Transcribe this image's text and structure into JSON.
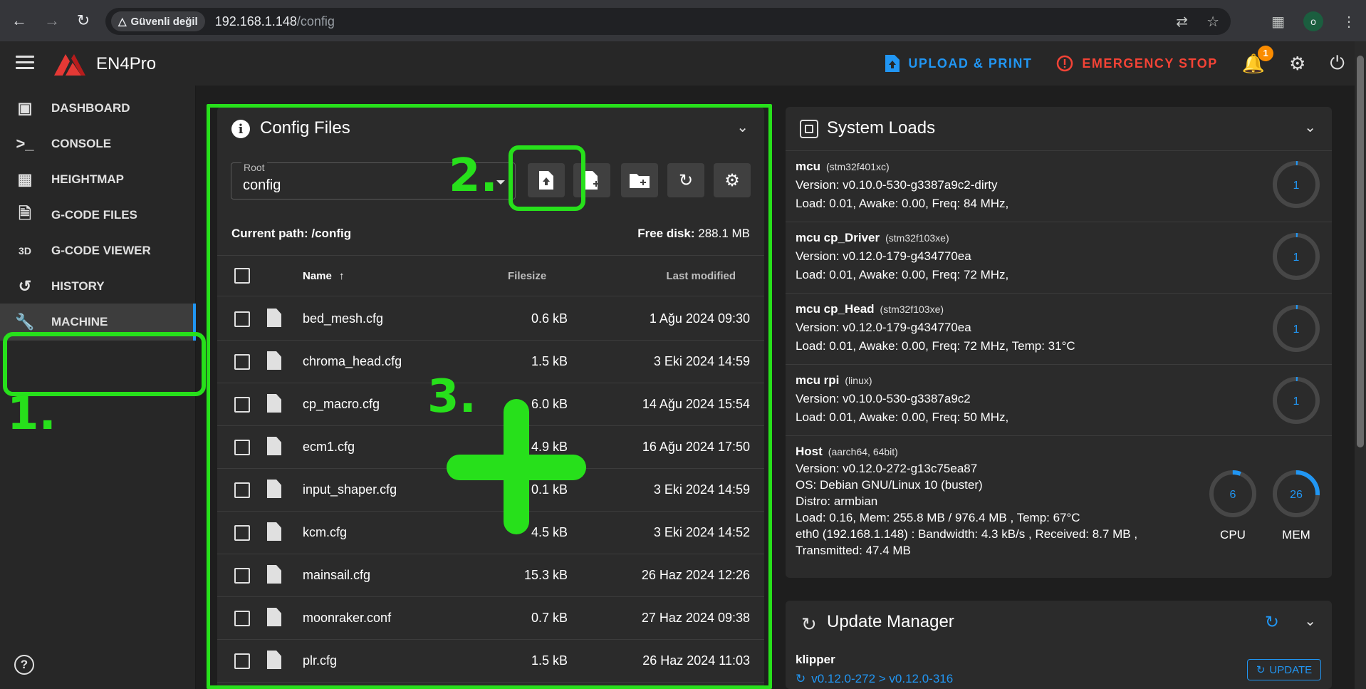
{
  "browser": {
    "secure_label": "Güvenli değil",
    "url_host": "192.168.1.148",
    "url_path": "/config",
    "profile_initial": "o"
  },
  "header": {
    "brand": "EN4Pro",
    "upload_print": "UPLOAD & PRINT",
    "emergency_stop": "EMERGENCY STOP",
    "notification_count": "1",
    "accent_color": "#2196f3",
    "estop_color": "#f44336"
  },
  "sidebar": {
    "items": [
      {
        "label": "DASHBOARD",
        "icon": "monitor-dashboard-icon"
      },
      {
        "label": "CONSOLE",
        "icon": "console-icon"
      },
      {
        "label": "HEIGHTMAP",
        "icon": "grid-icon"
      },
      {
        "label": "G-CODE FILES",
        "icon": "file-document-icon"
      },
      {
        "label": "G-CODE VIEWER",
        "icon": "3d-icon"
      },
      {
        "label": "HISTORY",
        "icon": "history-icon"
      },
      {
        "label": "MACHINE",
        "icon": "wrench-icon"
      }
    ],
    "icon_3d": "3D",
    "active": "MACHINE"
  },
  "annotations": {
    "n1": "1.",
    "n2": "2.",
    "n3": "3.",
    "color": "#27e01b"
  },
  "config_files": {
    "title": "Config Files",
    "root_label": "Root",
    "root_value": "config",
    "current_path_label": "Current path: /config",
    "free_disk_label": "Free disk:",
    "free_disk_value": "288.1 MB",
    "columns": {
      "name": "Name",
      "filesize": "Filesize",
      "modified": "Last modified"
    },
    "files": [
      {
        "name": "bed_mesh.cfg",
        "size": "0.6 kB",
        "modified": "1 Ağu 2024 09:30"
      },
      {
        "name": "chroma_head.cfg",
        "size": "1.5 kB",
        "modified": "3 Eki 2024 14:59"
      },
      {
        "name": "cp_macro.cfg",
        "size": "6.0 kB",
        "modified": "14 Ağu 2024 15:54"
      },
      {
        "name": "ecm1.cfg",
        "size": "4.9 kB",
        "modified": "16 Ağu 2024 17:50"
      },
      {
        "name": "input_shaper.cfg",
        "size": "0.1 kB",
        "modified": "3 Eki 2024 14:59"
      },
      {
        "name": "kcm.cfg",
        "size": "4.5 kB",
        "modified": "3 Eki 2024 14:52"
      },
      {
        "name": "mainsail.cfg",
        "size": "15.3 kB",
        "modified": "26 Haz 2024 12:26"
      },
      {
        "name": "moonraker.conf",
        "size": "0.7 kB",
        "modified": "27 Haz 2024 09:38"
      },
      {
        "name": "plr.cfg",
        "size": "1.5 kB",
        "modified": "26 Haz 2024 11:03"
      }
    ]
  },
  "system_loads": {
    "title": "System Loads",
    "mcus": [
      {
        "name": "mcu",
        "chip": "(stm32f401xc)",
        "version": "Version: v0.10.0-530-g3387a9c2-dirty",
        "load": "Load: 0.01, Awake: 0.00, Freq: 84 MHz,",
        "gauge": "1"
      },
      {
        "name": "mcu cp_Driver",
        "chip": "(stm32f103xe)",
        "version": "Version: v0.12.0-179-g434770ea",
        "load": "Load: 0.01, Awake: 0.00, Freq: 72 MHz,",
        "gauge": "1"
      },
      {
        "name": "mcu cp_Head",
        "chip": "(stm32f103xe)",
        "version": "Version: v0.12.0-179-g434770ea",
        "load": "Load: 0.01, Awake: 0.00, Freq: 72 MHz, Temp: 31°C",
        "gauge": "1"
      },
      {
        "name": "mcu rpi",
        "chip": "(linux)",
        "version": "Version: v0.10.0-530-g3387a9c2",
        "load": "Load: 0.01, Awake: 0.00, Freq: 50 MHz,",
        "gauge": "1"
      }
    ],
    "host": {
      "name": "Host",
      "chip": "(aarch64, 64bit)",
      "lines": [
        "Version: v0.12.0-272-g13c75ea87",
        "OS: Debian GNU/Linux 10 (buster)",
        "Distro: armbian",
        "Load: 0.16, Mem: 255.8 MB / 976.4 MB , Temp: 67°C",
        "eth0 (192.168.1.148) : Bandwidth: 4.3 kB/s , Received: 8.7 MB ,",
        "Transmitted: 47.4 MB"
      ],
      "cpu_value": "6",
      "cpu_label": "CPU",
      "mem_value": "26",
      "mem_label": "MEM"
    }
  },
  "update_manager": {
    "title": "Update Manager",
    "item_name": "klipper",
    "item_version": "v0.12.0-272 > v0.12.0-316",
    "update_label": "UPDATE"
  }
}
